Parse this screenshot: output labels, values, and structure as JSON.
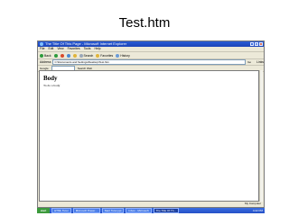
{
  "slide": {
    "title": "Test.htm"
  },
  "window": {
    "title": "The Title Of This Page - Microsoft Internet Explorer",
    "menu": [
      "File",
      "Edit",
      "View",
      "Favorites",
      "Tools",
      "Help"
    ],
    "toolbar": {
      "back": "Back",
      "search": "Search",
      "favorites": "Favorites",
      "history": "History"
    },
    "address": {
      "label": "Address",
      "value": "C:\\Documents and Settings\\Desktop\\Test.htm",
      "go": "Go",
      "links": "Links"
    },
    "google": {
      "label": "Google",
      "search": "Search Web"
    }
  },
  "page": {
    "heading": "Body",
    "text": "To do a body"
  },
  "status": {
    "left": "",
    "right": "My Computer"
  },
  "taskbar": {
    "start": "start",
    "tasks": [
      "HTML Tutor",
      "Microsoft Power...",
      "Start Tutor.ppt",
      "Inbox - Microsoft",
      "The Title Of Th..."
    ],
    "clock": "4:22 PM"
  },
  "colors": {
    "titlebar": "#2a5cd6",
    "taskbar": "#3a6ee0",
    "start": "#3c9a3c"
  }
}
